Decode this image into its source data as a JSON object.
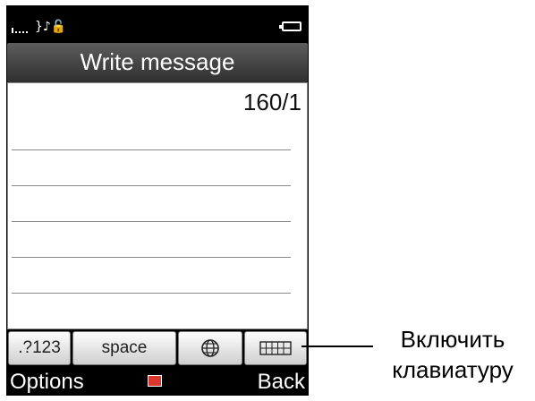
{
  "header": {
    "title": "Write message"
  },
  "editor": {
    "char_counter": "160/1"
  },
  "keyboard": {
    "symbols_label": ".?123",
    "space_label": "space",
    "language_icon": "globe-icon",
    "keypad_icon": "keypad-grid-icon"
  },
  "softkeys": {
    "left_label": "Options",
    "right_label": "Back",
    "center_icon": "message-envelope-icon"
  },
  "annotation": {
    "line1": "Включить",
    "line2": "клавиатуру"
  },
  "colors": {
    "title_gradient_top": "#5d5d5d",
    "title_gradient_bottom": "#2f2f2f",
    "envelope": "#d9382f"
  }
}
